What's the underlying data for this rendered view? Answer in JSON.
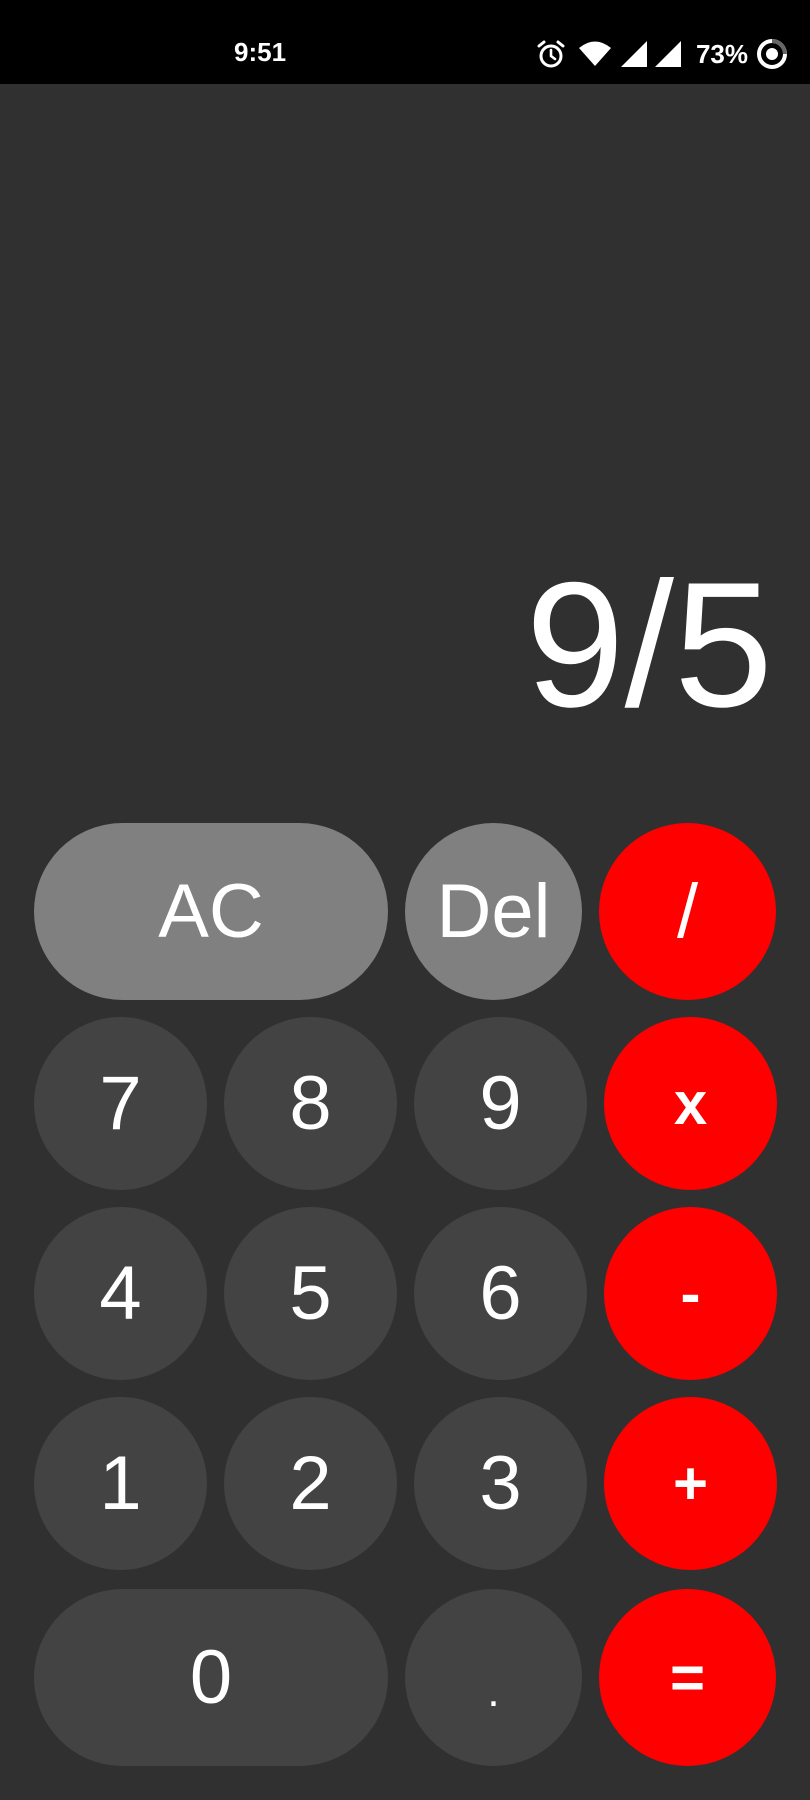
{
  "status_bar": {
    "time": "9:51",
    "battery_percent": "73%",
    "icons": [
      "alarm-icon",
      "wifi-icon",
      "signal-icon",
      "signal-icon",
      "battery-saver-icon"
    ]
  },
  "display": {
    "expression": "9/5"
  },
  "colors": {
    "background": "#303030",
    "function_key": "#808080",
    "digit_key": "#434343",
    "operator_key": "#ff0000",
    "text": "#ffffff"
  },
  "keypad": {
    "clear": "AC",
    "delete": "Del",
    "divide": "/",
    "multiply": "x",
    "subtract": "-",
    "add": "+",
    "equals": "=",
    "decimal": ".",
    "digits": {
      "d0": "0",
      "d1": "1",
      "d2": "2",
      "d3": "3",
      "d4": "4",
      "d5": "5",
      "d6": "6",
      "d7": "7",
      "d8": "8",
      "d9": "9"
    }
  }
}
